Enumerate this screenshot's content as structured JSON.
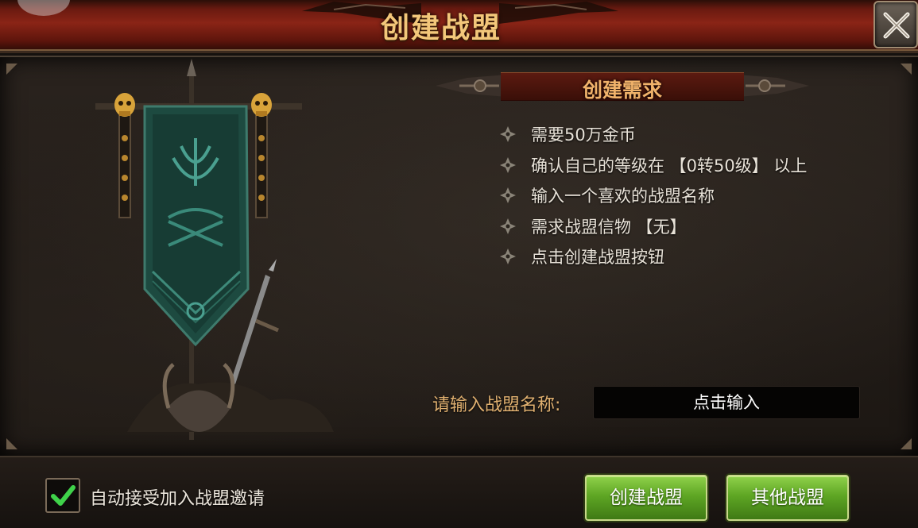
{
  "header": {
    "title": "创建战盟"
  },
  "requirements": {
    "title": "创建需求",
    "items": [
      "需要50万金币",
      "确认自己的等级在 【0转50级】 以上",
      "输入一个喜欢的战盟名称",
      "需求战盟信物 【无】",
      "点击创建战盟按钮"
    ]
  },
  "name_field": {
    "label": "请输入战盟名称:",
    "placeholder": "点击输入"
  },
  "footer": {
    "auto_accept_label": "自动接受加入战盟邀请",
    "auto_accept_checked": true,
    "create_button": "创建战盟",
    "other_button": "其他战盟"
  },
  "colors": {
    "title_gold": "#f3c77a",
    "header_red": "#8a2416",
    "banner_teal": "#1e4a40",
    "button_green": "#5ea624"
  },
  "icons": [
    "close-icon",
    "check-icon",
    "diamond-bullet-icon",
    "skull-icon",
    "guild-banner-icon"
  ]
}
